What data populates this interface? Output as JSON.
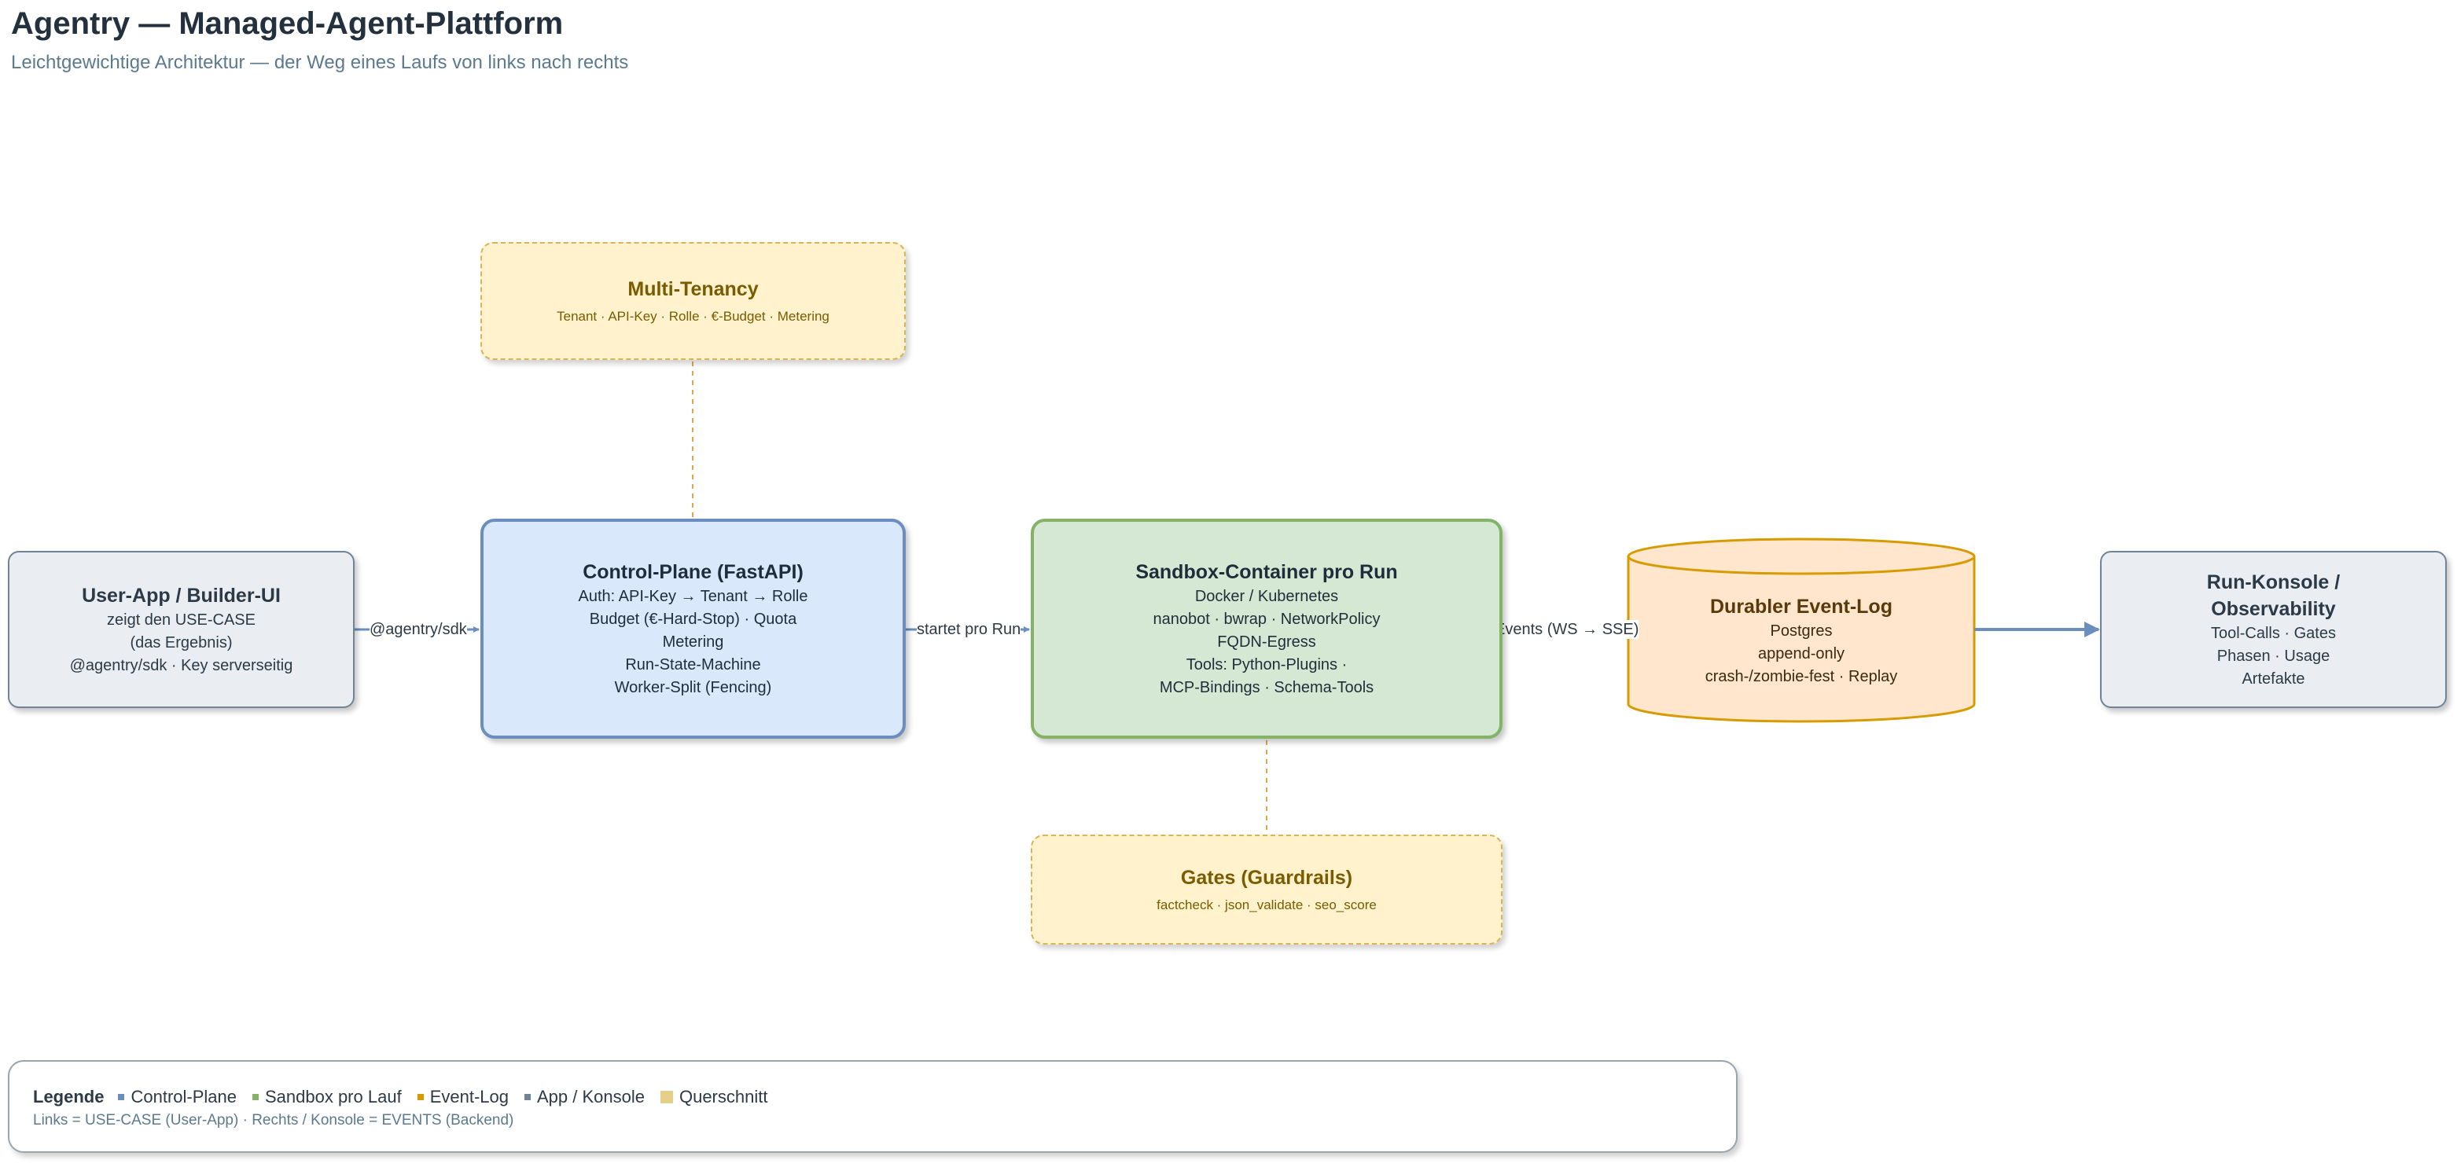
{
  "header": {
    "title": "Agentry — Managed-Agent-Plattform",
    "subtitle": "Leichtgewichtige Architektur — der Weg eines Laufs von links nach rechts"
  },
  "nodes": {
    "user_app": {
      "title": "User-App / Builder-UI",
      "lines": [
        "zeigt den USE-CASE",
        "(das Ergebnis)",
        "@agentry/sdk · Key serverseitig"
      ]
    },
    "control_plane": {
      "title": "Control-Plane (FastAPI)",
      "lines": [
        "Auth: API-Key → Tenant → Rolle",
        "Budget (€-Hard-Stop) · Quota",
        "Metering",
        "Run-State-Machine",
        "Worker-Split (Fencing)"
      ]
    },
    "sandbox": {
      "title": "Sandbox-Container pro Run",
      "lines": [
        "Docker / Kubernetes",
        "nanobot · bwrap · NetworkPolicy",
        "FQDN-Egress",
        "Tools: Python-Plugins ·",
        "MCP-Bindings · Schema-Tools"
      ]
    },
    "event_log": {
      "title": "Durabler Event-Log",
      "lines": [
        "Postgres",
        "append-only",
        "crash-/zombie-fest · Replay"
      ]
    },
    "run_konsole": {
      "title_lines": [
        "Run-Konsole /",
        "Observability"
      ],
      "lines": [
        "Tool-Calls · Gates",
        "Phasen · Usage",
        "Artefakte"
      ]
    },
    "multi_tenancy": {
      "title": "Multi-Tenancy",
      "subtitle": "Tenant · API-Key · Rolle · €-Budget · Metering"
    },
    "gates": {
      "title": "Gates (Guardrails)",
      "subtitle": "factcheck · json_validate · seo_score"
    }
  },
  "edges": {
    "user_to_control": "@agentry/sdk",
    "control_to_sandbox": "startet pro Run",
    "sandbox_to_eventlog": "Events (WS → SSE)"
  },
  "legend": {
    "title": "Legende",
    "items": [
      {
        "label": "Control-Plane",
        "color": "#6c8ebf"
      },
      {
        "label": "Sandbox pro Lauf",
        "color": "#82b366"
      },
      {
        "label": "Event-Log",
        "color": "#d79b00"
      },
      {
        "label": "App / Konsole",
        "color": "#6f8596"
      },
      {
        "label": "Querschnitt",
        "color": "#e6cf8a"
      }
    ],
    "note": "Links = USE-CASE (User-App) · Rechts / Konsole = EVENTS (Backend)"
  },
  "colors": {
    "control_fill": "#dae8fc",
    "control_stroke": "#6c8ebf",
    "sandbox_fill": "#d5e8d4",
    "sandbox_stroke": "#82b366",
    "eventlog_fill": "#ffe6cc",
    "eventlog_stroke": "#d79b00",
    "cross_fill": "#fff2cc",
    "cross_stroke": "#d6b656",
    "app_fill": "#eaeef2",
    "app_stroke": "#6f8596"
  }
}
